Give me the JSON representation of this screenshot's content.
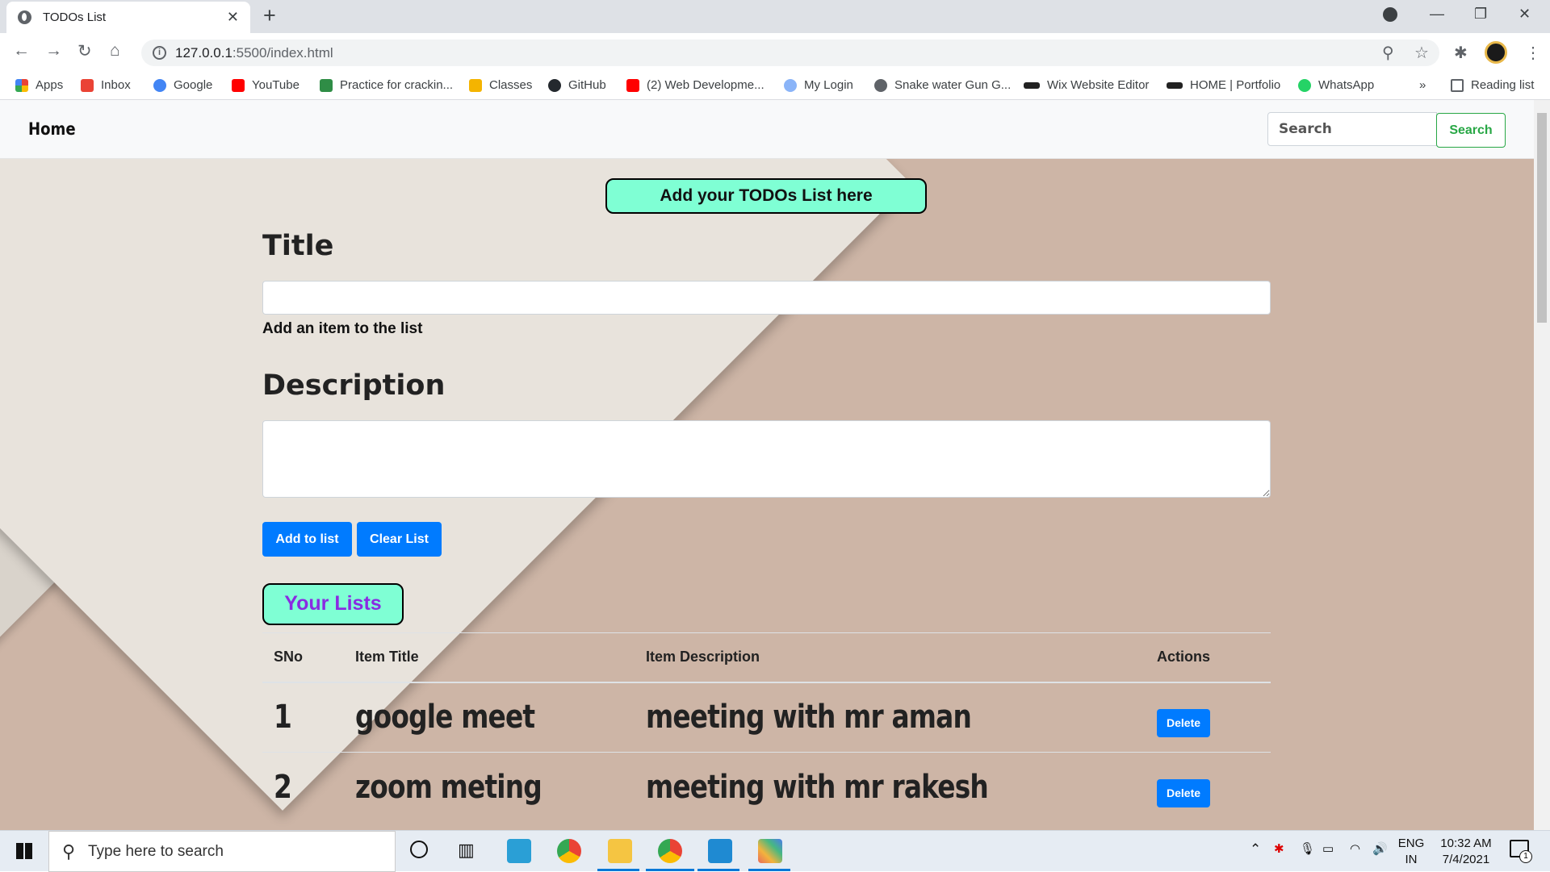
{
  "browser": {
    "tab_title": "TODOs List",
    "url_domain": "127.0.0.1",
    "url_path": ":5500/index.html",
    "bookmarks": [
      "Apps",
      "Inbox",
      "Google",
      "YouTube",
      "Practice for crackin...",
      "Classes",
      "GitHub",
      "(2) Web Developme...",
      "My Login",
      "Snake water Gun G...",
      "Wix Website Editor",
      "HOME | Portfolio",
      "WhatsApp"
    ],
    "overflow_label": "»",
    "reading_list": "Reading list"
  },
  "navbar": {
    "brand": "Home",
    "search_placeholder": "Search",
    "search_button": "Search"
  },
  "form": {
    "heading": "Add your TODOs List here",
    "title_label": "Title",
    "title_help": "Add an item to the list",
    "description_label": "Description",
    "add_button": "Add to list",
    "clear_button": "Clear List"
  },
  "lists": {
    "heading": "Your Lists",
    "columns": [
      "SNo",
      "Item Title",
      "Item Description",
      "Actions"
    ],
    "rows": [
      {
        "sno": "1",
        "title": "google meet",
        "description": "meeting with mr aman",
        "action": "Delete"
      },
      {
        "sno": "2",
        "title": "zoom meting",
        "description": "meeting with mr rakesh",
        "action": "Delete"
      }
    ]
  },
  "taskbar": {
    "search_placeholder": "Type here to search",
    "lang_top": "ENG",
    "lang_bottom": "IN",
    "time": "10:32 AM",
    "date": "7/4/2021",
    "notification_count": "1"
  },
  "colors": {
    "accent": "#007bff",
    "mint": "#7fffd4",
    "success": "#28a745",
    "lists_heading": "#8a2be2"
  }
}
